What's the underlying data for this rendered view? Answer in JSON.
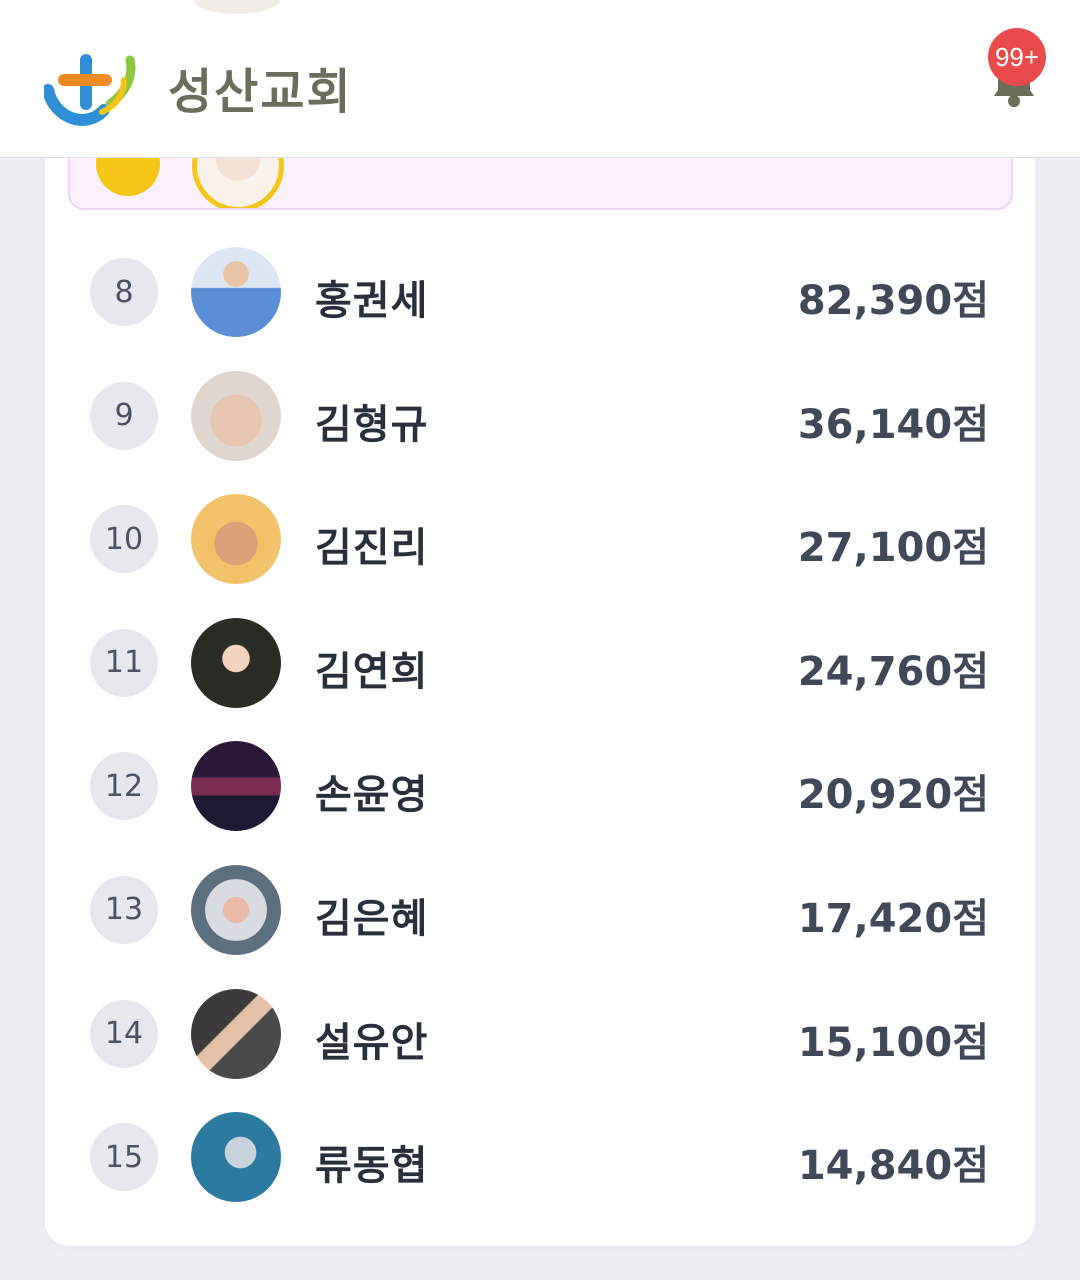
{
  "header": {
    "church_name": "성산교회",
    "notification_count": "99+"
  },
  "ranking": {
    "rows": [
      {
        "rank": "8",
        "name": "홍권세",
        "score": "82,390점"
      },
      {
        "rank": "9",
        "name": "김형규",
        "score": "36,140점"
      },
      {
        "rank": "10",
        "name": "김진리",
        "score": "27,100점"
      },
      {
        "rank": "11",
        "name": "김연희",
        "score": "24,760점"
      },
      {
        "rank": "12",
        "name": "손윤영",
        "score": "20,920점"
      },
      {
        "rank": "13",
        "name": "김은혜",
        "score": "17,420점"
      },
      {
        "rank": "14",
        "name": "설유안",
        "score": "15,100점"
      },
      {
        "rank": "15",
        "name": "류동협",
        "score": "14,840점"
      }
    ]
  },
  "colors": {
    "highlight_bg": "#fbf1fd",
    "gold": "#f5c518",
    "badge_red": "#e94b4b",
    "score_purple": "#7b3fcf"
  }
}
